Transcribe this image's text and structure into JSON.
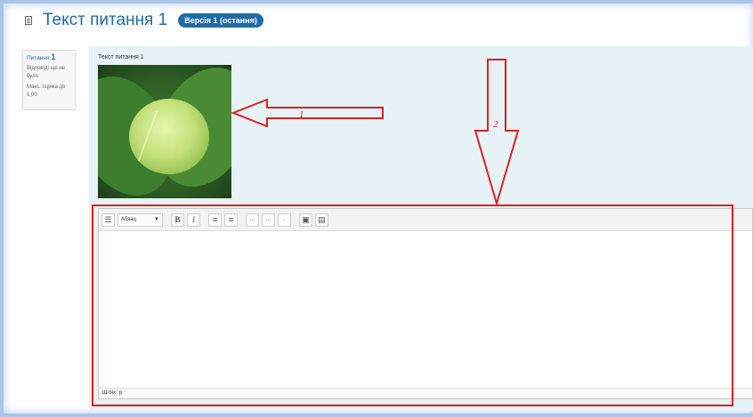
{
  "header": {
    "title": "Текст питання 1",
    "version_badge": "Версія 1 (остання)"
  },
  "info": {
    "question_label": "Питання",
    "question_number": "1",
    "status": "Відповіді ще не було",
    "max_mark": "Макс. оцінка до 1,00"
  },
  "question": {
    "text": "Текст питання 1",
    "image": "cabbage-image"
  },
  "editor": {
    "format_select": "Абзац",
    "toolbar_icons": [
      "toolbar-toggle-icon",
      "bold-icon",
      "italic-icon",
      "unordered-list-icon",
      "ordered-list-icon",
      "link-icon",
      "unlink-icon",
      "image-icon",
      "media-icon"
    ],
    "path_label": "Шлях: p"
  },
  "annotations": {
    "arrow1_label": "1",
    "arrow2_label": "2",
    "color": "#e02020"
  },
  "colors": {
    "accent": "#1f6aa8",
    "content_bg": "#e6f2f5"
  }
}
